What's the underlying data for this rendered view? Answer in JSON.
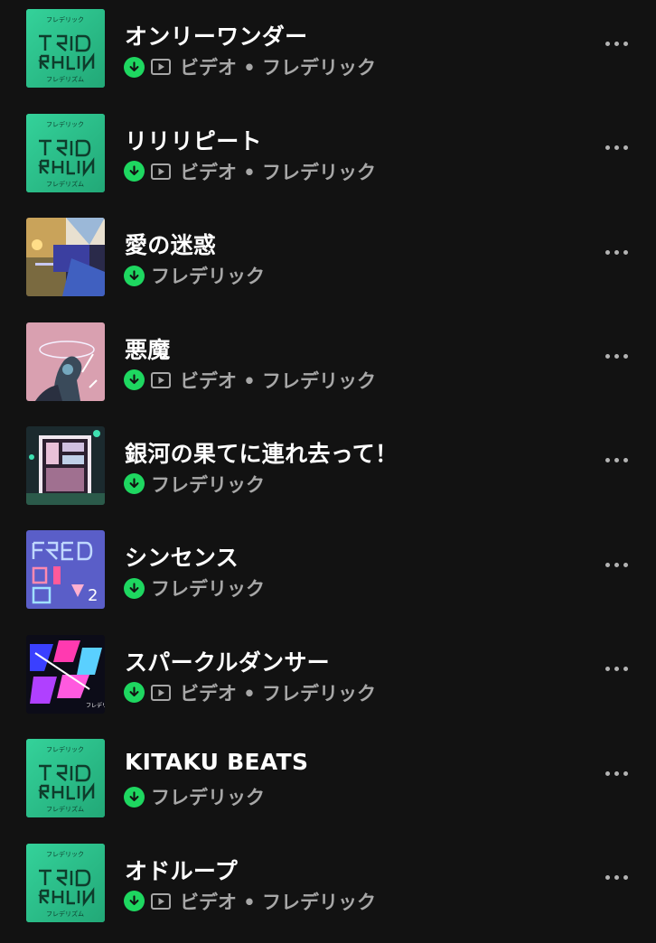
{
  "tracks": [
    {
      "title": "",
      "subtitle": "フレデリック",
      "video": false,
      "art": "art-generic"
    },
    {
      "title": "オンリーワンダー",
      "subtitle": "ビデオ • フレデリック",
      "video": true,
      "art": "art-green"
    },
    {
      "title": "リリリピート",
      "subtitle": "ビデオ • フレデリック",
      "video": true,
      "art": "art-green"
    },
    {
      "title": "愛の迷惑",
      "subtitle": "フレデリック",
      "video": false,
      "art": "art-collage"
    },
    {
      "title": "悪魔",
      "subtitle": "ビデオ • フレデリック",
      "video": true,
      "art": "art-pink"
    },
    {
      "title": "銀河の果てに連れ去って！",
      "subtitle": "フレデリック",
      "video": false,
      "art": "art-galaxy"
    },
    {
      "title": "シンセンス",
      "subtitle": "フレデリック",
      "video": false,
      "art": "art-purple"
    },
    {
      "title": "スパークルダンサー",
      "subtitle": "ビデオ • フレデリック",
      "video": true,
      "art": "art-neon"
    },
    {
      "title": "KITAKU BEATS",
      "subtitle": "フレデリック",
      "video": false,
      "art": "art-green"
    },
    {
      "title": "オドループ",
      "subtitle": "ビデオ • フレデリック",
      "video": true,
      "art": "art-green"
    }
  ],
  "colors": {
    "background": "#121212",
    "download_badge": "#1ed760",
    "subtitle": "#a7a7a7"
  },
  "icons": {
    "download": "download-arrow-icon",
    "video": "video-play-icon",
    "more": "more-options-icon"
  }
}
